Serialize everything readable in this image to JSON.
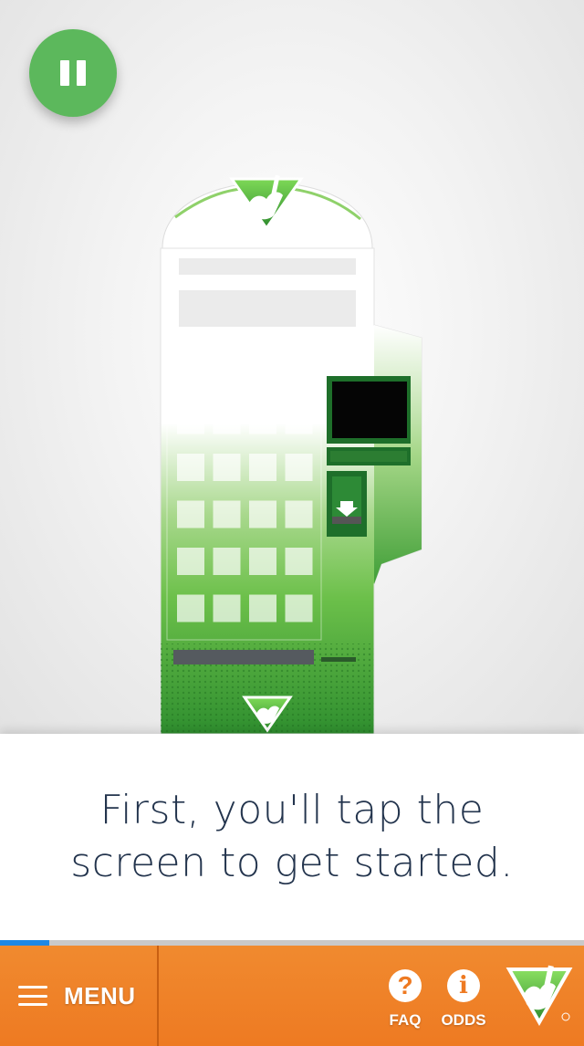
{
  "caption": {
    "text": "First, you'll tap the screen to get started."
  },
  "progress": {
    "fraction": 0.085
  },
  "nav": {
    "menu_label": "MENU",
    "faq_label": "FAQ",
    "odds_label": "ODDS",
    "faq_glyph": "?",
    "odds_glyph": "i"
  },
  "icons": {
    "pause": "pause-icon",
    "menu": "hamburger-icon",
    "faq": "question-icon",
    "odds": "info-icon",
    "logo": "lottery-hand-logo"
  },
  "colors": {
    "pause_button": "#5cb85c",
    "nav_background": "#ee7a22",
    "progress_fill": "#1e88e5",
    "caption_text": "#23344d",
    "kiosk_green": "#3fa23a"
  }
}
